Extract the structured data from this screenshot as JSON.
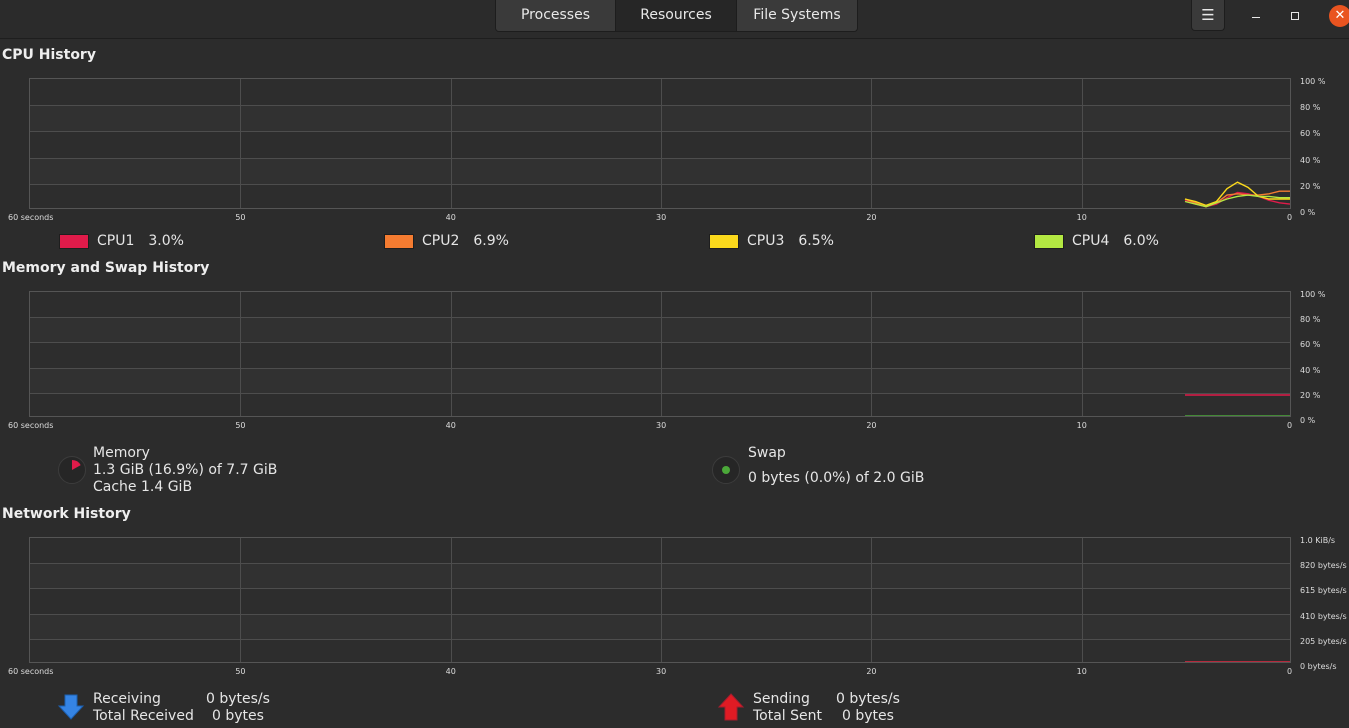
{
  "tabs": [
    {
      "label": "Processes"
    },
    {
      "label": "Resources"
    },
    {
      "label": "File Systems"
    }
  ],
  "header": {
    "menu_icon": "hamburger-icon",
    "minimize_icon": "minimize-icon",
    "maximize_icon": "maximize-icon",
    "close_icon": "close-icon",
    "close_color": "#e95420"
  },
  "x_axis": {
    "ticks": [
      "60 seconds",
      "50",
      "40",
      "30",
      "20",
      "10",
      "0"
    ]
  },
  "cpu": {
    "title": "CPU History",
    "y_ticks": [
      "100 %",
      "80 %",
      "60 %",
      "40 %",
      "20 %",
      "0 %"
    ],
    "cores": [
      {
        "name": "CPU1",
        "value": "3.0%",
        "color": "#e01b4a"
      },
      {
        "name": "CPU2",
        "value": "6.9%",
        "color": "#f57c31"
      },
      {
        "name": "CPU3",
        "value": "6.5%",
        "color": "#fbd91c"
      },
      {
        "name": "CPU4",
        "value": "6.0%",
        "color": "#b3e842"
      }
    ]
  },
  "memory": {
    "title": "Memory and Swap History",
    "y_ticks": [
      "100 %",
      "80 %",
      "60 %",
      "40 %",
      "20 %",
      "0 %"
    ],
    "memory_label": "Memory",
    "memory_usage": "1.3 GiB (16.9%) of 7.7 GiB",
    "cache": "Cache 1.4 GiB",
    "memory_fraction": 0.169,
    "memory_color": "#e01b4a",
    "swap_label": "Swap",
    "swap_usage": "0 bytes (0.0%) of 2.0 GiB",
    "swap_color": "#4ba839"
  },
  "network": {
    "title": "Network History",
    "y_ticks": [
      "1.0 KiB/s",
      "820 bytes/s",
      "615 bytes/s",
      "410 bytes/s",
      "205 bytes/s",
      "0 bytes/s"
    ],
    "receiving_label": "Receiving",
    "receiving_rate": "0 bytes/s",
    "total_received_label": "Total Received",
    "total_received": "0 bytes",
    "sending_label": "Sending",
    "sending_rate": "0 bytes/s",
    "total_sent_label": "Total Sent",
    "total_sent": "0 bytes",
    "receive_icon": "arrow-down-icon",
    "send_icon": "arrow-up-icon",
    "receive_color": "#3584e4",
    "send_color": "#e01b24"
  },
  "chart_data": [
    {
      "type": "line",
      "title": "CPU History",
      "x": [
        5,
        4.5,
        4,
        3.5,
        3,
        2.5,
        2,
        1.5,
        1,
        0.5,
        0
      ],
      "xlim": [
        60,
        0
      ],
      "ylim": [
        0,
        100
      ],
      "series": [
        {
          "name": "CPU1",
          "values": [
            6,
            3,
            1,
            3,
            8,
            12,
            11,
            9,
            6,
            4,
            3
          ]
        },
        {
          "name": "CPU2",
          "values": [
            7,
            4,
            1,
            4,
            10,
            11,
            10,
            10,
            11,
            13,
            13
          ]
        },
        {
          "name": "CPU3",
          "values": [
            7,
            5,
            2,
            5,
            15,
            20,
            16,
            9,
            7,
            7,
            7
          ]
        },
        {
          "name": "CPU4",
          "values": [
            5,
            3,
            1,
            4,
            7,
            9,
            10,
            9,
            9,
            8,
            8
          ]
        }
      ]
    },
    {
      "type": "line",
      "title": "Memory and Swap History",
      "x": [
        5,
        0
      ],
      "xlim": [
        60,
        0
      ],
      "ylim": [
        0,
        100
      ],
      "series": [
        {
          "name": "Memory",
          "values": [
            16.9,
            16.9
          ]
        },
        {
          "name": "Swap",
          "values": [
            0,
            0
          ]
        }
      ]
    },
    {
      "type": "line",
      "title": "Network History",
      "x": [
        5,
        0
      ],
      "xlim": [
        60,
        0
      ],
      "series": [
        {
          "name": "Receiving",
          "values": [
            0,
            0
          ]
        },
        {
          "name": "Sending",
          "values": [
            0,
            0
          ]
        }
      ]
    }
  ]
}
